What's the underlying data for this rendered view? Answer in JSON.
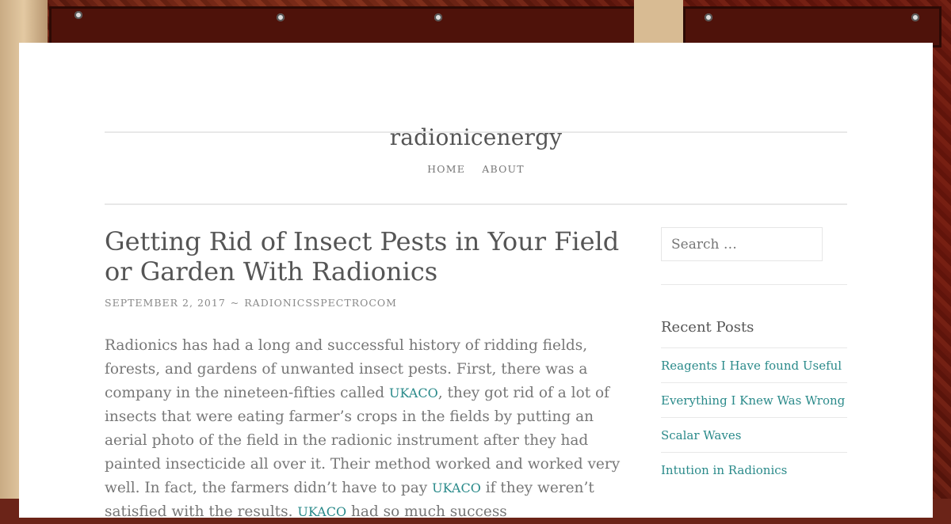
{
  "site": {
    "title": "radionicenergy"
  },
  "nav": {
    "items": [
      "HOME",
      "ABOUT"
    ]
  },
  "post": {
    "title": "Getting Rid of Insect Pests in Your Field or Garden With Radionics",
    "date": "SEPTEMBER 2, 2017",
    "separator": "~",
    "author": "RADIONICSSPECTROCOM",
    "paragraph": [
      {
        "t": "text",
        "v": "Radionics has had a long and successful history of ridding fields, forests, and gardens of unwanted insect pests.  First, there was a company in the nineteen-fifties called "
      },
      {
        "t": "link",
        "v": "UKACO"
      },
      {
        "t": "text",
        "v": ", they got rid of a lot of insects that were eating farmer’s crops in the fields by putting an aerial photo of the field in the radionic instrument after they had painted insecticide all over it.  Their method worked and worked very well. In fact, the farmers didn’t have to pay "
      },
      {
        "t": "link",
        "v": "UKACO"
      },
      {
        "t": "text",
        "v": " if they weren’t satisfied with the results. "
      },
      {
        "t": "link",
        "v": "UKACO"
      },
      {
        "t": "text",
        "v": " had so much success"
      }
    ]
  },
  "sidebar": {
    "search_placeholder": "Search …",
    "recent_heading": "Recent Posts",
    "recent_posts": [
      "Reagents I Have found Useful",
      "Everything I Knew Was Wrong",
      "Scalar Waves",
      "Intution in Radionics"
    ]
  }
}
